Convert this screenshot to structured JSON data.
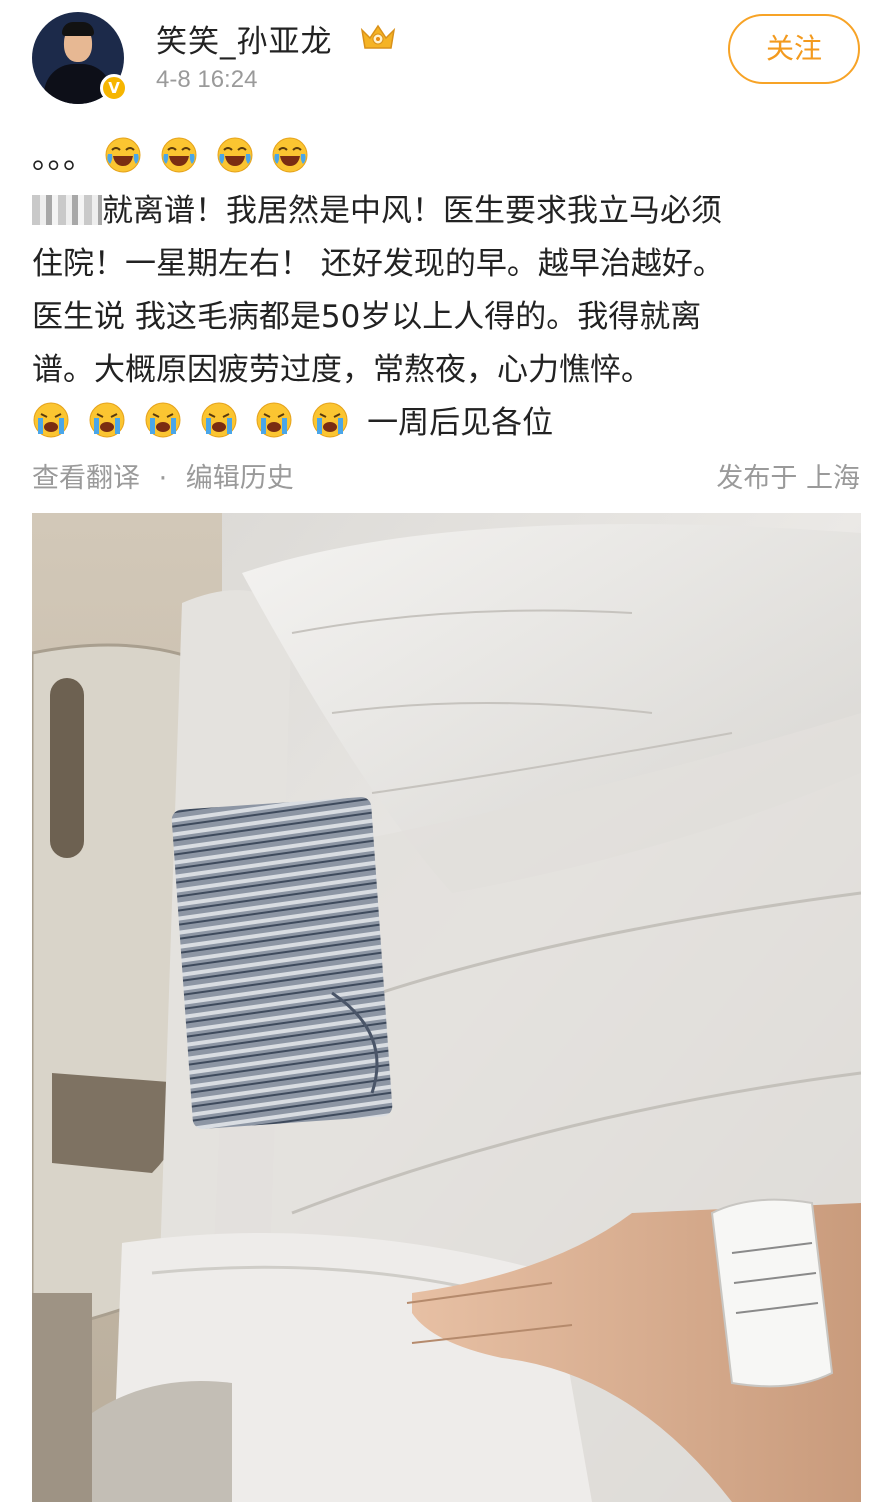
{
  "post": {
    "username": "笑笑_孙亚龙",
    "timestamp": "4-8 16:24",
    "follow_label": "关注",
    "text_line1_prefix": "。。。",
    "text_line2_rest": "就离谱！我居然是中风！医生要求我立马必须",
    "text_line3": "住院！一星期左右！ 还好发现的早。越早治越好。",
    "text_line4": "医生说 我这毛病都是50岁以上人得的。我得就离",
    "text_line5": "谱。大概原因疲劳过度，常熬夜，心力憔悴。",
    "text_line6_suffix": "一周后见各位",
    "view_translation": "查看翻译",
    "separator": "·",
    "edit_history": "编辑历史",
    "location": "发布于 上海"
  },
  "icons": {
    "laugh_emoji_count_line1": 4,
    "cry_emoji_count_line6": 6,
    "laugh_emoji": "laughing-tears-emoji-icon",
    "cry_emoji": "crying-emoji-icon",
    "crown": "crown-badge-icon",
    "verified": "verified-v-icon"
  },
  "colors": {
    "follow_accent": "#f39a1e",
    "meta_gray": "#9a9a9a",
    "verified_gold": "#f6b500"
  },
  "verified_label": "V"
}
